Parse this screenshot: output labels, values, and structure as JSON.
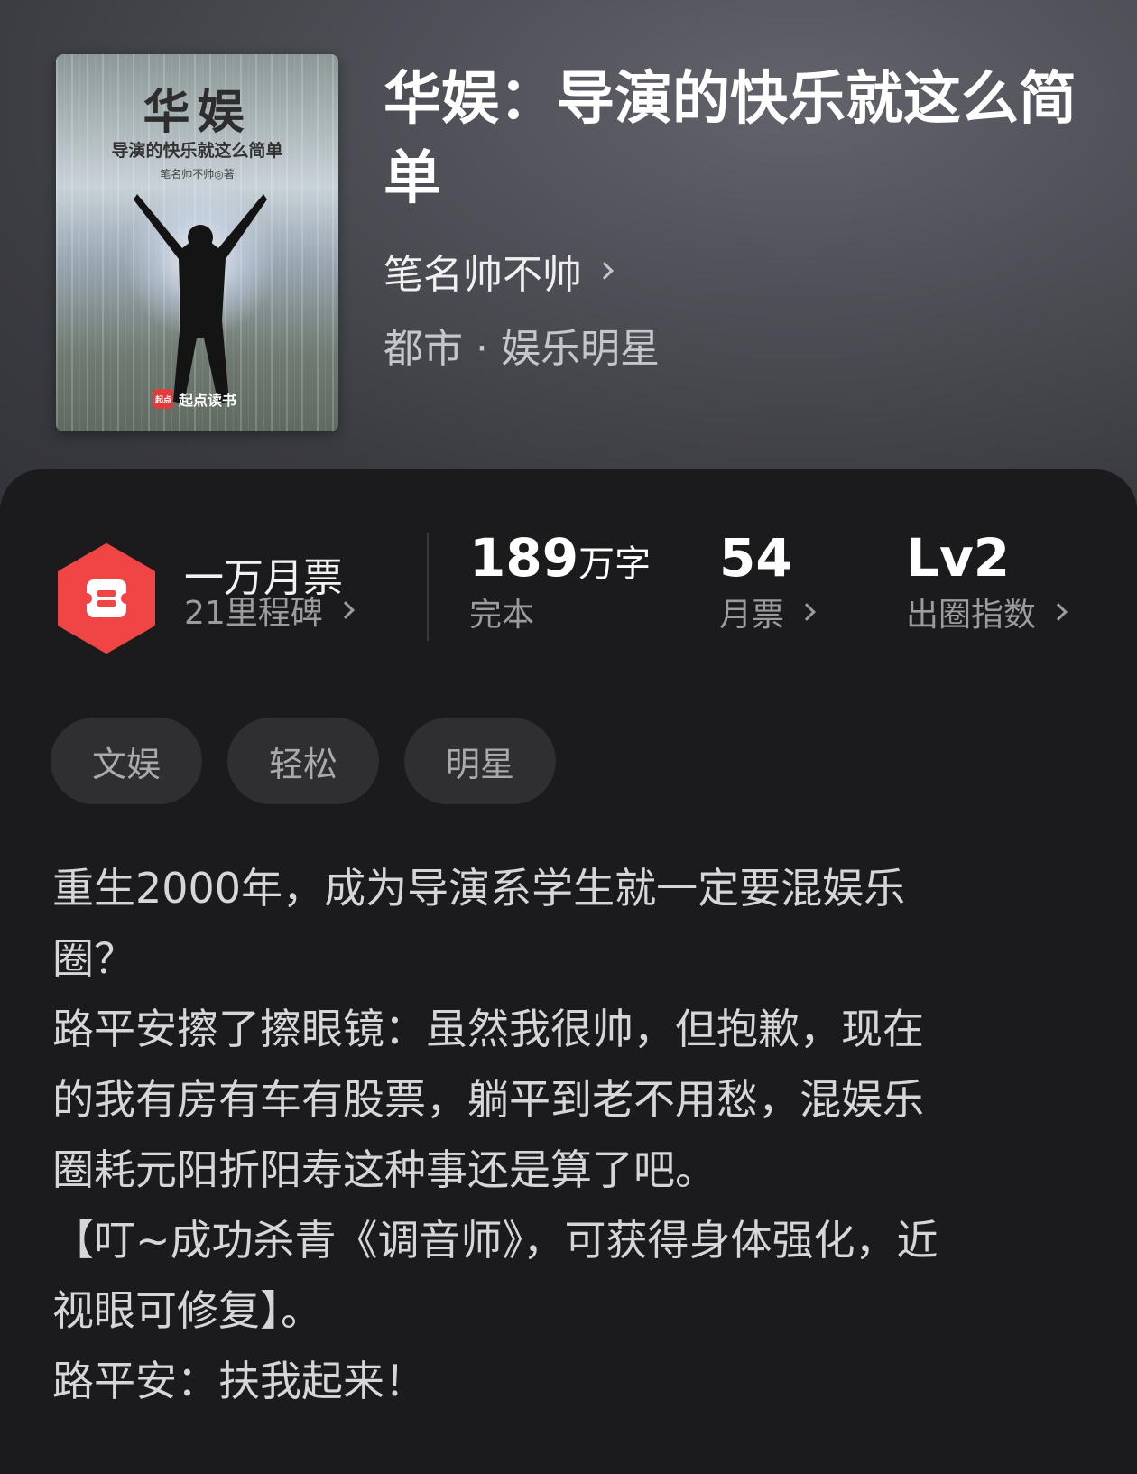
{
  "book": {
    "title": "华娱：导演的快乐就这么简单",
    "author": "笔名帅不帅",
    "genre": "都市 · 娱乐明星"
  },
  "cover": {
    "title": "华娱",
    "subtitle": "导演的快乐就这么简单",
    "author_line": "笔名帅不帅◎著",
    "publisher": "起点读书",
    "publisher_badge": "起点"
  },
  "stats": {
    "ticket": {
      "title": "一万月票",
      "sub": "21里程碑"
    },
    "words": {
      "number": "189",
      "unit": "万字",
      "label": "完本"
    },
    "monthly": {
      "number": "54",
      "label": "月票"
    },
    "level": {
      "number": "Lv2",
      "label": "出圈指数"
    }
  },
  "tags": [
    "文娱",
    "轻松",
    "明星"
  ],
  "description": [
    "重生2000年，成为导演系学生就一定要混娱乐",
    "圈？",
    "路平安擦了擦眼镜：虽然我很帅，但抱歉，现在",
    "的我有房有车有股票，躺平到老不用愁，混娱乐",
    "圈耗元阳折阳寿这种事还是算了吧。",
    "【叮~成功杀青《调音师》，可获得身体强化，近",
    "视眼可修复】。",
    "路平安：扶我起来！"
  ],
  "colors": {
    "ticket_red": "#f04545",
    "panel_bg": "#1b1b1d",
    "tag_bg": "#2f2f31"
  }
}
